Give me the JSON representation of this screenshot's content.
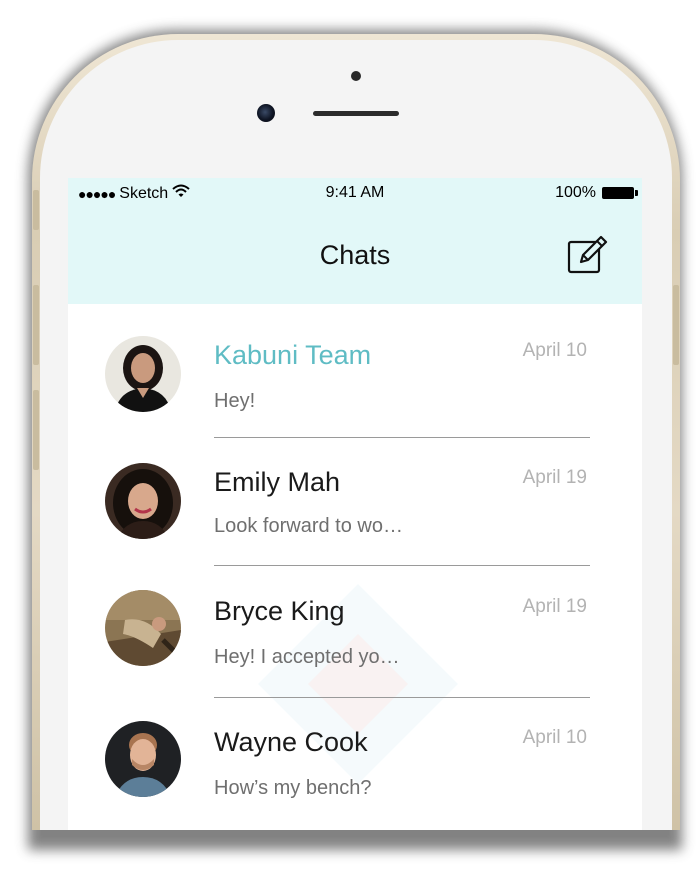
{
  "status_bar": {
    "signal_dots": "●●●●●",
    "carrier": "Sketch",
    "wifi_icon": "wifi-icon",
    "time": "9:41 AM",
    "battery_percent": "100%",
    "battery_icon": "battery-icon"
  },
  "nav": {
    "title": "Chats",
    "compose_icon": "compose-icon"
  },
  "chats": [
    {
      "name": "Kabuni Team",
      "preview": "Hey!",
      "date": "April 10",
      "highlighted": true
    },
    {
      "name": "Emily Mah",
      "preview": "Look forward to wo…",
      "date": "April 19",
      "highlighted": false
    },
    {
      "name": "Bryce King",
      "preview": "Hey! I accepted yo…",
      "date": "April 19",
      "highlighted": false
    },
    {
      "name": "Wayne Cook",
      "preview": "How’s my bench?",
      "date": "April 10",
      "highlighted": false
    }
  ],
  "colors": {
    "header_background": "#e2f8f8",
    "accent_name": "#5fbcc4",
    "date_text": "#b3b3b3",
    "phone_frame": "#d9cdb4"
  }
}
